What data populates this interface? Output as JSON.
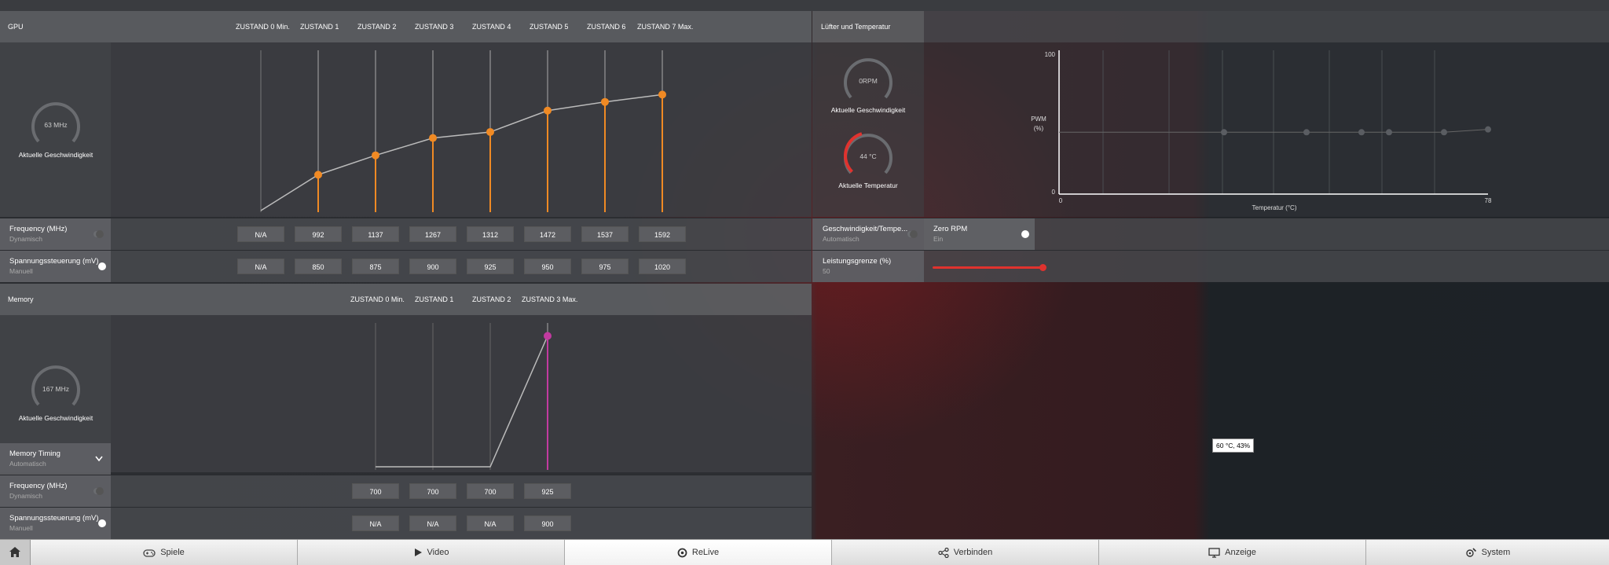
{
  "gpu": {
    "section_title": "GPU",
    "states": [
      "ZUSTAND 0 Min.",
      "ZUSTAND 1",
      "ZUSTAND 2",
      "ZUSTAND 3",
      "ZUSTAND 4",
      "ZUSTAND 5",
      "ZUSTAND 6",
      "ZUSTAND 7 Max."
    ],
    "gauge_value": "63 MHz",
    "gauge_label": "Aktuelle Geschwindigkeit",
    "frequency": {
      "label": "Frequency (MHz)",
      "mode": "Dynamisch",
      "values": [
        "N/A",
        "992",
        "1137",
        "1267",
        "1312",
        "1472",
        "1537",
        "1592"
      ]
    },
    "voltage": {
      "label": "Spannungssteuerung (mV)",
      "mode": "Manuell",
      "values": [
        "N/A",
        "850",
        "875",
        "900",
        "925",
        "950",
        "975",
        "1020"
      ]
    }
  },
  "memory": {
    "section_title": "Memory",
    "states": [
      "ZUSTAND 0 Min.",
      "ZUSTAND 1",
      "ZUSTAND 2",
      "ZUSTAND 3 Max."
    ],
    "gauge_value": "167 MHz",
    "gauge_label": "Aktuelle Geschwindigkeit",
    "timing": {
      "label": "Memory Timing",
      "mode": "Automatisch"
    },
    "frequency": {
      "label": "Frequency (MHz)",
      "mode": "Dynamisch",
      "values": [
        "700",
        "700",
        "700",
        "925"
      ]
    },
    "voltage": {
      "label": "Spannungssteuerung (mV)",
      "mode": "Manuell",
      "values": [
        "N/A",
        "N/A",
        "N/A",
        "900"
      ]
    }
  },
  "fan": {
    "section_title": "Lüfter und Temperatur",
    "speed_value": "0RPM",
    "speed_label": "Aktuelle Geschwindigkeit",
    "temp_value": "44 °C",
    "temp_label": "Aktuelle Temperatur",
    "temp_fraction": 0.44,
    "chart_ylabel": "PWM\n(%)",
    "chart_ylabel_1": "PWM",
    "chart_ylabel_2": "(%)",
    "chart_y_max": "100",
    "chart_y_min": "0",
    "chart_x_min": "0",
    "chart_x_max": "78",
    "chart_xlabel": "Temperatur (°C)",
    "speed_temp": {
      "label": "Geschwindigkeit/Tempe...",
      "mode": "Automatisch"
    },
    "zero_rpm": {
      "label": "Zero RPM",
      "mode": "Ein"
    },
    "power_limit": {
      "label": "Leistungsgrenze (%)",
      "value": "50",
      "fraction": 0.5
    },
    "tooltip": "60 °C, 43%"
  },
  "nav": {
    "home_icon": "home-icon",
    "tabs": [
      {
        "label": "Spiele",
        "icon": "gamepad-icon"
      },
      {
        "label": "Video",
        "icon": "play-icon"
      },
      {
        "label": "ReLive",
        "icon": "relive-icon"
      },
      {
        "label": "Verbinden",
        "icon": "share-icon"
      },
      {
        "label": "Anzeige",
        "icon": "monitor-icon"
      },
      {
        "label": "System",
        "icon": "system-icon"
      }
    ],
    "active_tab": "ReLive"
  },
  "colors": {
    "accent_orange": "#f08a24",
    "accent_magenta": "#c23aa0",
    "accent_red": "#e0322e"
  },
  "chart_data": [
    {
      "type": "line",
      "title": "GPU",
      "categories": [
        "ZUSTAND 0 Min.",
        "ZUSTAND 1",
        "ZUSTAND 2",
        "ZUSTAND 3",
        "ZUSTAND 4",
        "ZUSTAND 5",
        "ZUSTAND 6",
        "ZUSTAND 7 Max."
      ],
      "series": [
        {
          "values": [
            852,
            992,
            1137,
            1267,
            1312,
            1472,
            1537,
            1592
          ]
        }
      ]
    },
    {
      "type": "line",
      "title": "Memory",
      "categories": [
        "ZUSTAND 0 Min.",
        "ZUSTAND 1",
        "ZUSTAND 2",
        "ZUSTAND 3 Max."
      ],
      "series": [
        {
          "values": [
            700,
            700,
            700,
            925
          ]
        }
      ]
    },
    {
      "type": "line",
      "title": "Lüfter und Temperatur",
      "xlabel": "Temperatur (°C)",
      "ylabel": "PWM (%)",
      "xlim": [
        0,
        78
      ],
      "ylim": [
        0,
        100
      ],
      "series": [
        {
          "x": [
            0,
            30,
            45,
            55,
            60,
            70,
            78
          ],
          "y": [
            43,
            43,
            43,
            43,
            43,
            43,
            45
          ]
        }
      ]
    }
  ]
}
